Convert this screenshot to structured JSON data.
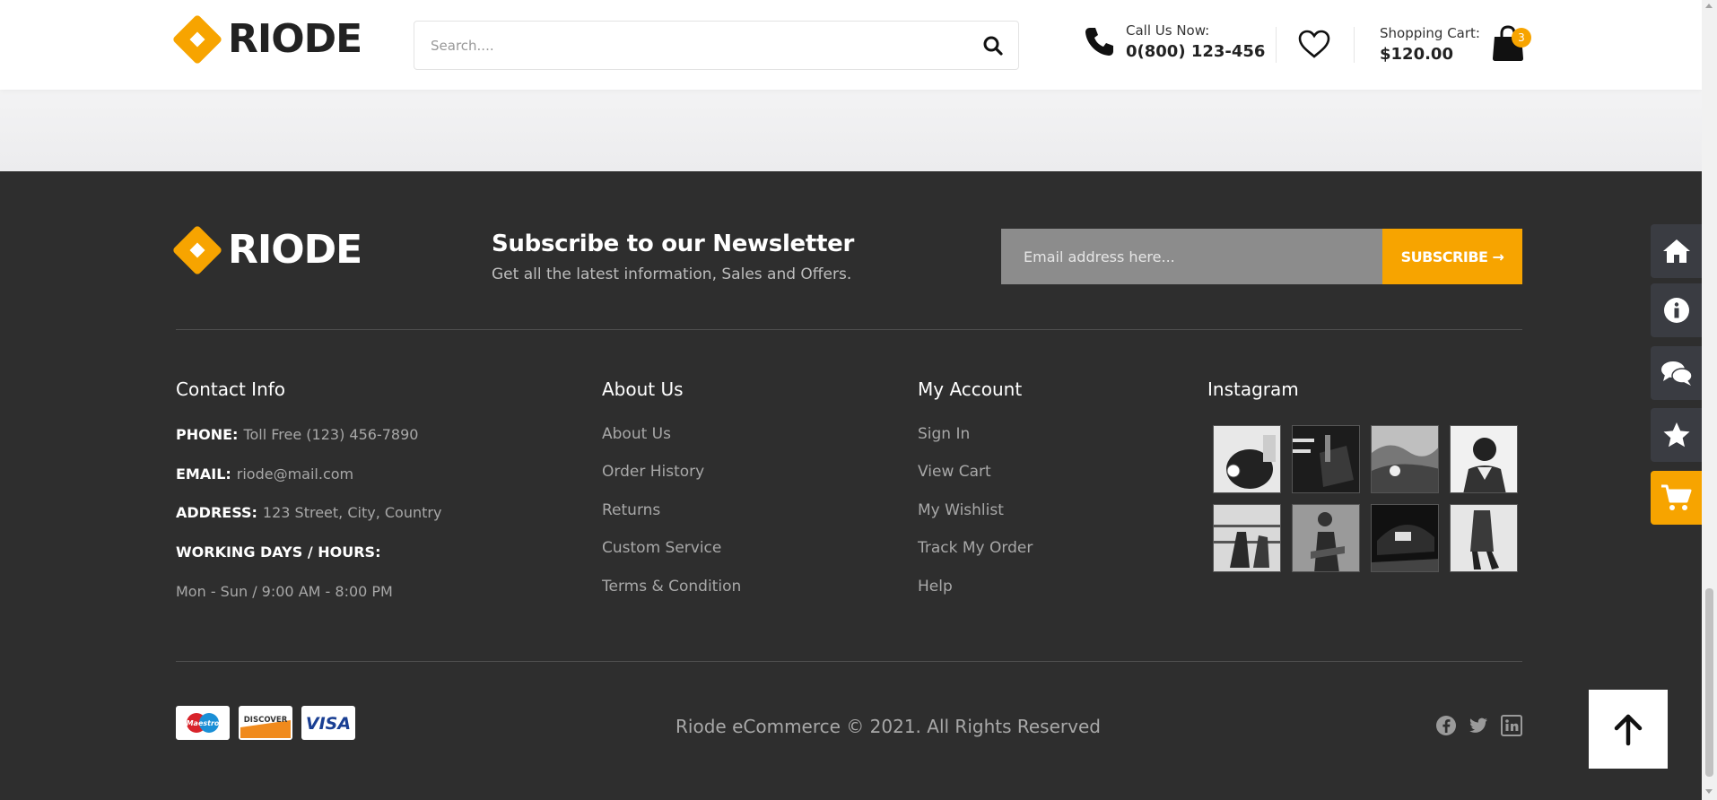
{
  "brand": {
    "name": "RIODE",
    "accent": "#f7a400"
  },
  "header": {
    "search_placeholder": "Search....",
    "call_label": "Call Us Now:",
    "call_number": "0(800) 123-456",
    "cart_label": "Shopping Cart:",
    "cart_total": "$120.00",
    "cart_count": "3"
  },
  "newsletter": {
    "title": "Subscribe to our Newsletter",
    "subtitle": "Get all the latest information, Sales and Offers.",
    "email_placeholder": "Email address here...",
    "button": "SUBSCRIBE →"
  },
  "contact": {
    "title": "Contact Info",
    "phone_label": "PHONE:",
    "phone": "Toll Free (123) 456-7890",
    "email_label": "EMAIL:",
    "email": "riode@mail.com",
    "address_label": "ADDRESS:",
    "address": "123 Street, City, Country",
    "hours_label": "WORKING DAYS / HOURS:",
    "hours": "Mon - Sun / 9:00 AM - 8:00 PM"
  },
  "about": {
    "title": "About Us",
    "links": [
      "About Us",
      "Order History",
      "Returns",
      "Custom Service",
      "Terms & Condition"
    ]
  },
  "account": {
    "title": "My Account",
    "links": [
      "Sign In",
      "View Cart",
      "My Wishlist",
      "Track My Order",
      "Help"
    ]
  },
  "instagram": {
    "title": "Instagram"
  },
  "payments": [
    "Maestro",
    "DISCOVER",
    "VISA"
  ],
  "copyright": "Riode eCommerce © 2021. All Rights Reserved",
  "icons": {
    "social": [
      "facebook-icon",
      "twitter-icon",
      "linkedin-icon"
    ],
    "sidebar": [
      "home-icon",
      "info-icon",
      "chat-icon",
      "star-icon",
      "cart-icon"
    ]
  }
}
